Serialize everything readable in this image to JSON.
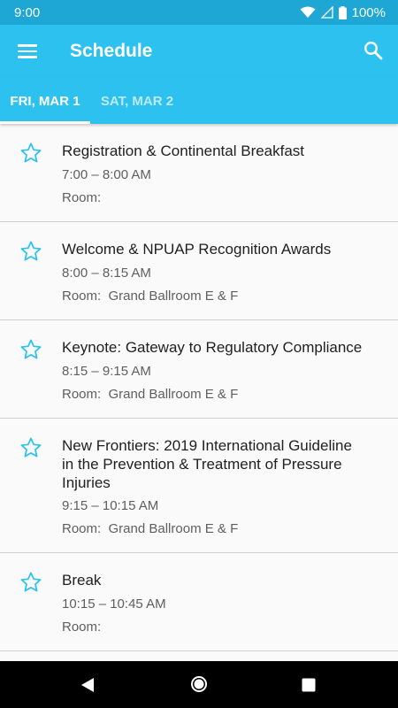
{
  "status_bar": {
    "time": "9:00",
    "battery": "100%",
    "icons": [
      "wifi-icon",
      "cell-signal-icon",
      "battery-icon"
    ]
  },
  "app_bar": {
    "title": "Schedule",
    "menu_icon": "hamburger-menu-icon",
    "search_icon": "search-icon",
    "color": "#2cc1ef"
  },
  "tabs": [
    {
      "label": "FRI, MAR 1",
      "selected": true
    },
    {
      "label": "SAT, MAR 2",
      "selected": false
    }
  ],
  "sessions": [
    {
      "title": "Registration & Continental Breakfast",
      "time": "7:00 – 8:00 AM",
      "room": "Room:  "
    },
    {
      "title": "Welcome & NPUAP Recognition Awards",
      "time": "8:00 – 8:15 AM",
      "room": "Room:  Grand Ballroom E & F"
    },
    {
      "title": "Keynote: Gateway to Regulatory Compliance",
      "time": "8:15 – 9:15 AM",
      "room": "Room:  Grand Ballroom E & F"
    },
    {
      "title": "New Frontiers: 2019 International Guideline in the Prevention & Treatment of Pressure Injuries",
      "time": "9:15 – 10:15 AM",
      "room": "Room:  Grand Ballroom E & F"
    },
    {
      "title": "Break",
      "time": "10:15 – 10:45 AM",
      "room": "Room:  "
    }
  ],
  "nav_bar": {
    "icons": [
      "back-icon",
      "home-icon",
      "recents-icon"
    ]
  },
  "colors": {
    "accent": "#2cc1ef",
    "status_bar": "#1ea6d4",
    "star_outline": "#2cc1ef"
  }
}
